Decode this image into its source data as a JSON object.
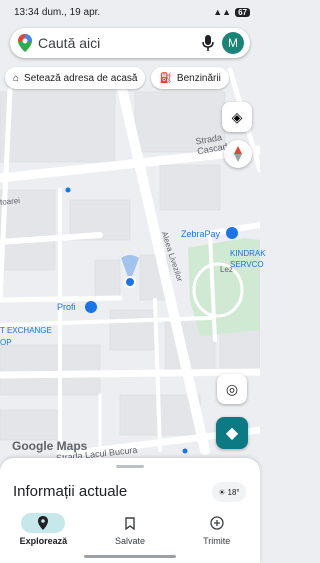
{
  "status_bar": {
    "time": "13:34",
    "date": "dum., 19 apr.",
    "battery": "67"
  },
  "search": {
    "placeholder": "Caută aici",
    "avatar_initial": "M"
  },
  "chips": [
    {
      "label": "Setează adresa de acasă",
      "icon": "home-icon"
    },
    {
      "label": "Benzinării",
      "icon": "gas-station-icon"
    }
  ],
  "map": {
    "labels": {
      "street_strada_cascadei": "Strada Cascadei",
      "street_aleea_livezilor": "Aleea Livezilor",
      "street_lacul_bucura": "Strada Lacul Bucura",
      "street_moarei": "toarei",
      "poi_zebrapay": "ZebraPay",
      "poi_kindrak_1": "KINDRAK",
      "poi_kindrak_2": "SERVCO",
      "poi_profi": "Profi",
      "poi_exchange_1": "T EXCHANGE",
      "poi_exchange_2": "OP",
      "street_lez": "Lez",
      "google_maps": "Google Maps"
    }
  },
  "sheet": {
    "title": "Informații actuale",
    "temperature": "18°"
  },
  "bottom_nav": [
    {
      "label": "Explorează",
      "icon": "location-pin-icon",
      "active": true
    },
    {
      "label": "Salvate",
      "icon": "bookmark-icon",
      "active": false
    },
    {
      "label": "Trimite",
      "icon": "add-circle-icon",
      "active": false
    }
  ],
  "colors": {
    "accent": "#0b7a83",
    "park": "#cfe9d2",
    "location": "#1a73e8",
    "avatar": "#1a8577"
  }
}
